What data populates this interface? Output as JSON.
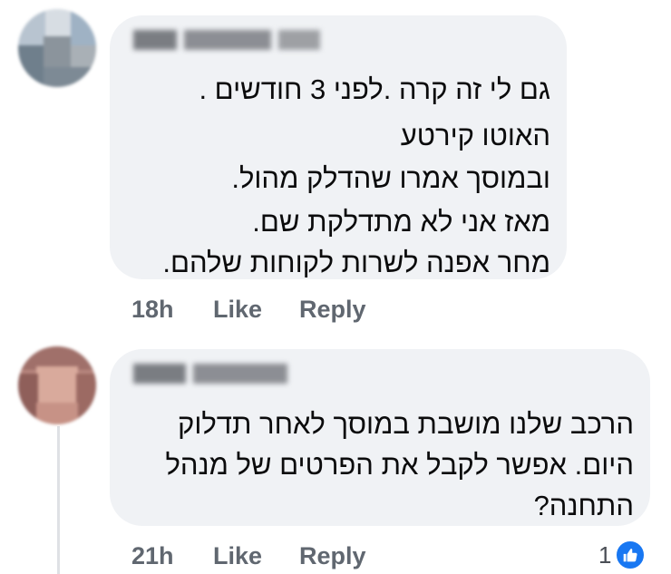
{
  "comments": [
    {
      "author_redacted": true,
      "lines": [
        "גם לי זה קרה .לפני 3 חודשים .",
        "האוטו קירטע",
        "ובמוסך אמרו שהדלק מהול.",
        "מאז אני לא מתדלקת שם.",
        "מחר אפנה לשרות לקוחות שלהם."
      ],
      "time": "18h",
      "like_label": "Like",
      "reply_label": "Reply"
    },
    {
      "author_redacted": true,
      "lines": [
        "הרכב שלנו מושבת במוסך לאחר תדלוק",
        "היום. אפשר לקבל את הפרטים של מנהל",
        "התחנה?"
      ],
      "time": "21h",
      "like_label": "Like",
      "reply_label": "Reply",
      "reaction": {
        "count": "1",
        "icon": "thumbs-up-icon",
        "color": "#1877f2"
      }
    }
  ],
  "colors": {
    "bubble": "#f0f2f5",
    "text": "#0b0b0c",
    "meta": "#606770",
    "like_blue": "#1877f2"
  }
}
